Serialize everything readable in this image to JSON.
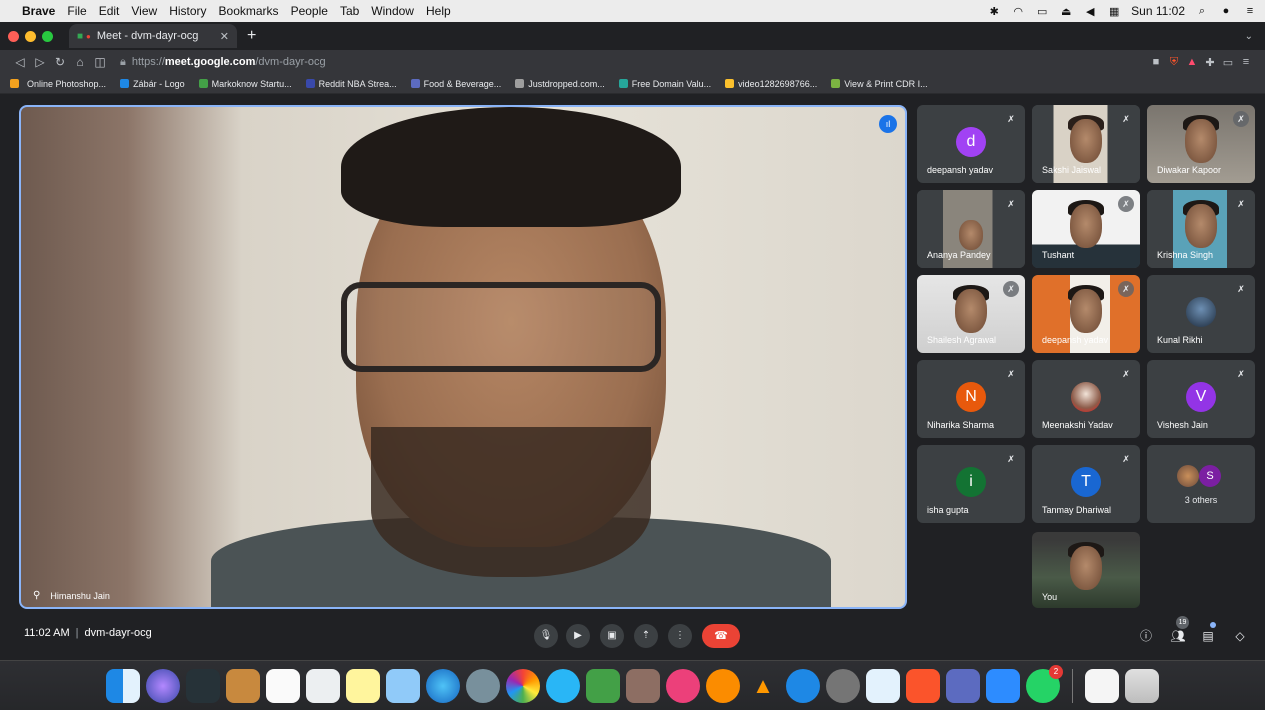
{
  "menubar": {
    "app": "Brave",
    "items": [
      "File",
      "Edit",
      "View",
      "History",
      "Bookmarks",
      "People",
      "Tab",
      "Window",
      "Help"
    ],
    "clock": "Sun 11:02"
  },
  "browser": {
    "tab_title": "Meet - dvm-dayr-ocg",
    "url_prefix": "https://",
    "url_domain": "meet.google.com",
    "url_path": "/dvm-dayr-ocg",
    "bookmarks": [
      {
        "label": "Online Photoshop...",
        "color": "#f4a21e"
      },
      {
        "label": "Zábár - Logo",
        "color": "#1e88e5"
      },
      {
        "label": "Markoknow Startu...",
        "color": "#43a047"
      },
      {
        "label": "Reddit NBA Strea...",
        "color": "#3949ab"
      },
      {
        "label": "Food & Beverage...",
        "color": "#5c6bc0"
      },
      {
        "label": "Justdropped.com...",
        "color": "#9e9e9e"
      },
      {
        "label": "Free Domain Valu...",
        "color": "#26a69a"
      },
      {
        "label": "video1282698766...",
        "color": "#fbc02d"
      },
      {
        "label": "View & Print CDR I...",
        "color": "#7cb342"
      }
    ]
  },
  "meet": {
    "speaker_name": "Himanshu Jain",
    "participants": [
      {
        "name": "deepansh yadav",
        "initial": "d",
        "avatar_color": "#a142f4",
        "kind": "initial"
      },
      {
        "name": "Sakshi Jaiswal",
        "kind": "video",
        "bg": "#d9d2c6"
      },
      {
        "name": "Diwakar Kapoor",
        "kind": "video",
        "bg": "#8f8a83"
      },
      {
        "name": "Ananya Pandey",
        "kind": "video",
        "bg": "#6d6a63"
      },
      {
        "name": "Tushant",
        "kind": "video",
        "bg": "#e6e6e6"
      },
      {
        "name": "Krishna Singh",
        "kind": "video",
        "bg": "#4d8fa8"
      },
      {
        "name": "Shailesh Agrawal",
        "kind": "video",
        "bg": "#dcdcdc"
      },
      {
        "name": "deepansh yadav",
        "kind": "video",
        "bg": "#e0702a"
      },
      {
        "name": "Kunal Rikhi",
        "kind": "photo"
      },
      {
        "name": "Niharika Sharma",
        "initial": "N",
        "avatar_color": "#e8590c",
        "kind": "initial"
      },
      {
        "name": "Meenakshi Yadav",
        "kind": "photo"
      },
      {
        "name": "Vishesh Jain",
        "initial": "V",
        "avatar_color": "#9334e6",
        "kind": "initial"
      },
      {
        "name": "isha gupta",
        "initial": "i",
        "avatar_color": "#137333",
        "kind": "initial"
      },
      {
        "name": "Tanmay Dhariwal",
        "initial": "T",
        "avatar_color": "#1967d2",
        "kind": "initial"
      }
    ],
    "others_label": "3 others",
    "others_initial": "S",
    "self_label": "You",
    "time": "11:02 AM",
    "meeting_code": "dvm-dayr-ocg",
    "people_count": "19",
    "dock_badge": "2"
  }
}
